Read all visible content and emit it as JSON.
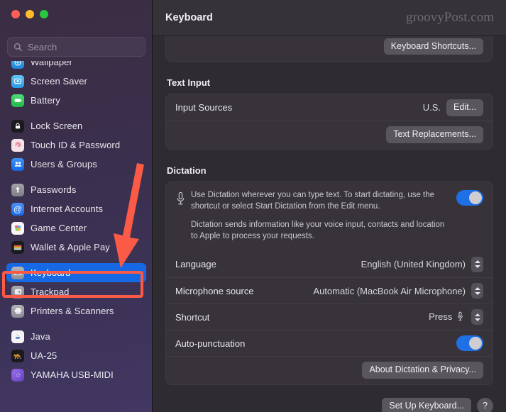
{
  "window": {
    "traffic_lights": [
      {
        "name": "close",
        "color": "#ff5f57"
      },
      {
        "name": "minimize",
        "color": "#febc2e"
      },
      {
        "name": "maximize",
        "color": "#28c840"
      }
    ]
  },
  "sidebar": {
    "search": {
      "placeholder": "Search",
      "value": "",
      "icon": "search-icon"
    },
    "groups": [
      {
        "clipped_top": true,
        "items": [
          {
            "label": "Wallpaper",
            "icon": "wallpaper-icon",
            "icon_color": "#2f9ee8",
            "selected": false,
            "clipped": true
          },
          {
            "label": "Screen Saver",
            "icon": "screen-saver-icon",
            "icon_color": "#46b0f0",
            "selected": false
          },
          {
            "label": "Battery",
            "icon": "battery-icon",
            "icon_color": "#35c759",
            "selected": false
          }
        ]
      },
      {
        "items": [
          {
            "label": "Lock Screen",
            "icon": "lock-screen-icon",
            "icon_color": "#1c1c1e",
            "selected": false
          },
          {
            "label": "Touch ID & Password",
            "icon": "touch-id-icon",
            "icon_color": "#f4dde2",
            "selected": false
          },
          {
            "label": "Users & Groups",
            "icon": "users-groups-icon",
            "icon_color": "#1f7aec",
            "selected": false
          }
        ]
      },
      {
        "items": [
          {
            "label": "Passwords",
            "icon": "passwords-icon",
            "icon_color": "#8e8e93",
            "selected": false
          },
          {
            "label": "Internet Accounts",
            "icon": "internet-accounts-icon",
            "icon_color": "#2f7cf6",
            "selected": false
          },
          {
            "label": "Game Center",
            "icon": "game-center-icon",
            "icon_color": "#f7f7fa",
            "selected": false
          },
          {
            "label": "Wallet & Apple Pay",
            "icon": "wallet-apple-pay-icon",
            "icon_color": "#1c1c1e",
            "selected": false
          }
        ]
      },
      {
        "items": [
          {
            "label": "Keyboard",
            "icon": "keyboard-icon",
            "icon_color": "#9fa0a5",
            "selected": true
          },
          {
            "label": "Trackpad",
            "icon": "trackpad-icon",
            "icon_color": "#8e8e93",
            "selected": false
          },
          {
            "label": "Printers & Scanners",
            "icon": "printers-scanners-icon",
            "icon_color": "#9a9aa0",
            "selected": false
          }
        ]
      },
      {
        "items": [
          {
            "label": "Java",
            "icon": "java-icon",
            "icon_color": "#f2f2f4",
            "selected": false
          },
          {
            "label": "UA-25",
            "icon": "ua-25-icon",
            "icon_color": "#1b1b1d",
            "selected": false
          },
          {
            "label": "YAMAHA USB-MIDI",
            "icon": "yamaha-usb-midi-icon",
            "icon_color": "#6d4bbd",
            "selected": false
          }
        ]
      }
    ]
  },
  "header": {
    "title": "Keyboard",
    "watermark": "groovyPost.com"
  },
  "main": {
    "top_card": {
      "button_label": "Keyboard Shortcuts..."
    },
    "text_input": {
      "section_title": "Text Input",
      "input_sources": {
        "label": "Input Sources",
        "value": "U.S.",
        "button_label": "Edit..."
      },
      "text_replacements_button": "Text Replacements..."
    },
    "dictation": {
      "section_title": "Dictation",
      "icon": "microphone-icon",
      "description_1": "Use Dictation wherever you can type text. To start dictating, use the shortcut or select Start Dictation from the Edit menu.",
      "description_2": "Dictation sends information like your voice input, contacts and location to Apple to process your requests.",
      "enabled": true,
      "rows": [
        {
          "label": "Language",
          "value": "English (United Kingdom)",
          "control": "stepper"
        },
        {
          "label": "Microphone source",
          "value": "Automatic (MacBook Air Microphone)",
          "control": "stepper"
        },
        {
          "label": "Shortcut",
          "value": "Press",
          "control": "stepper",
          "has_mic_glyph": true
        }
      ],
      "auto_punctuation": {
        "label": "Auto-punctuation",
        "enabled": true
      },
      "about_button": "About Dictation & Privacy..."
    },
    "bottom_partial": {
      "button_label": "Set Up Keyboard...",
      "help_label": "?"
    }
  },
  "annotation": {
    "highlight_color": "#fb5a47",
    "arrow_color": "#fb5a47",
    "points_to": "Keyboard"
  }
}
